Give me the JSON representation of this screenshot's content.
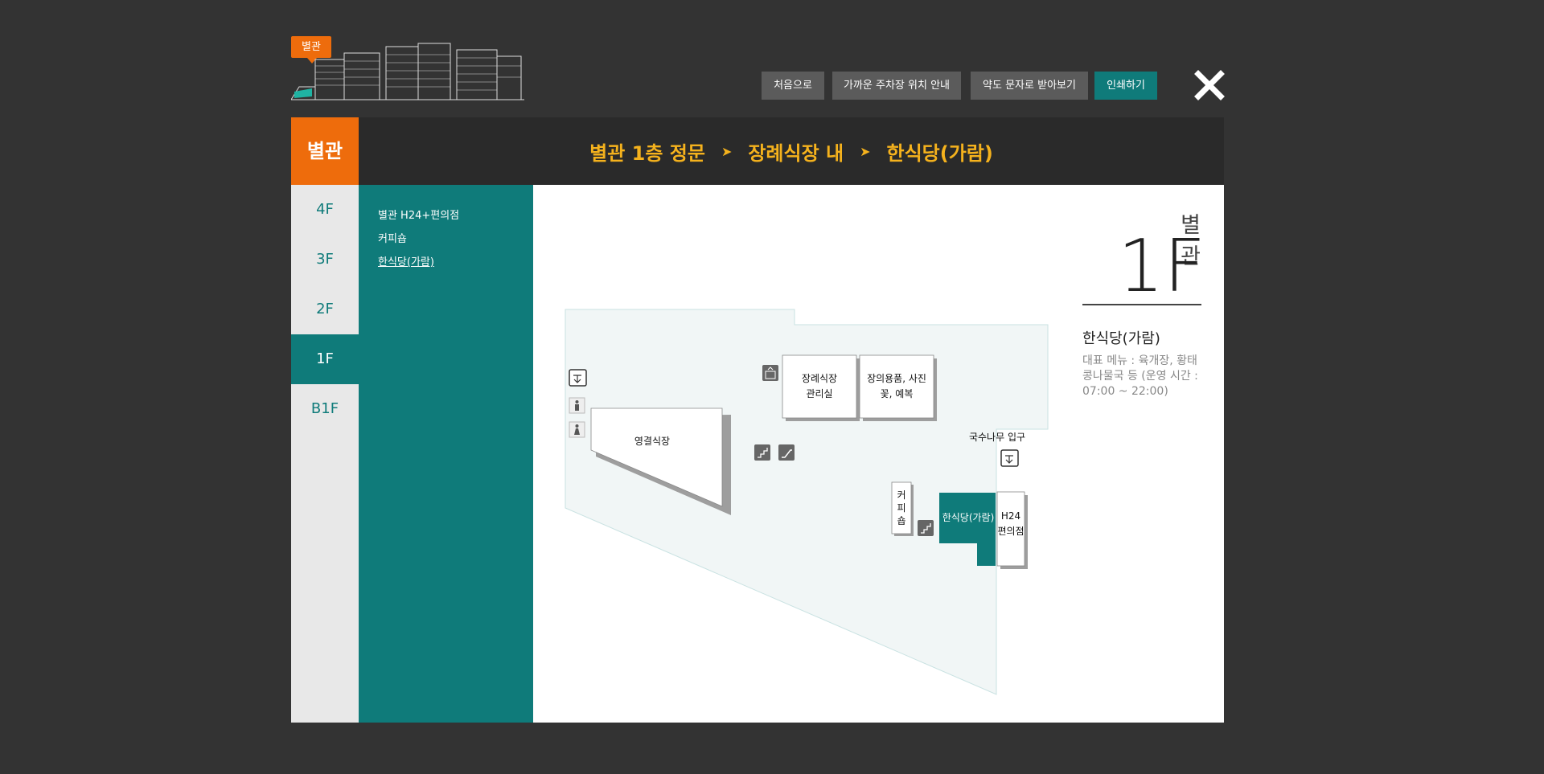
{
  "header": {
    "building_badge": "별관",
    "buttons": {
      "home": "처음으로",
      "parking": "가까운 주차장 위치 안내",
      "sms": "약도 문자로 받아보기",
      "print": "인쇄하기"
    }
  },
  "building_tab": "별관",
  "breadcrumb": {
    "items": [
      "별관 1층 정문",
      "장례식장 내",
      "한식당(가람)"
    ],
    "separator": "➤"
  },
  "floors": [
    "4F",
    "3F",
    "2F",
    "1F",
    "B1F"
  ],
  "active_floor": "1F",
  "facilities": [
    "별관 H24+편의점",
    "커피숍",
    "한식당(가람)"
  ],
  "selected_facility": "한식당(가람)",
  "info": {
    "building": "별관",
    "floor": "1F",
    "name": "한식당(가람)",
    "description": "대표 메뉴 : 육개장, 황태콩나물국 등 (운영 시간 : 07:00 ~ 22:00)"
  },
  "map_labels": {
    "hall": "영결식장",
    "office_line1": "장례식장",
    "office_line2": "관리실",
    "supplies_line1": "장의용품, 사진",
    "supplies_line2": "꽃, 예복",
    "entrance": "국수나무 입구",
    "coffee_1": "커",
    "coffee_2": "피",
    "coffee_3": "숍",
    "restaurant": "한식당(가람)",
    "store_line1": "H24",
    "store_line2": "편의점"
  },
  "colors": {
    "background": "#333333",
    "accent_orange": "#ee6c0c",
    "accent_teal": "#0f7b7a",
    "breadcrumb_gold": "#f5b21d"
  },
  "icons": [
    "close-icon",
    "exit-icon",
    "male-restroom-icon",
    "female-restroom-icon",
    "elevator-icon",
    "stairs-icon",
    "escalator-icon"
  ]
}
